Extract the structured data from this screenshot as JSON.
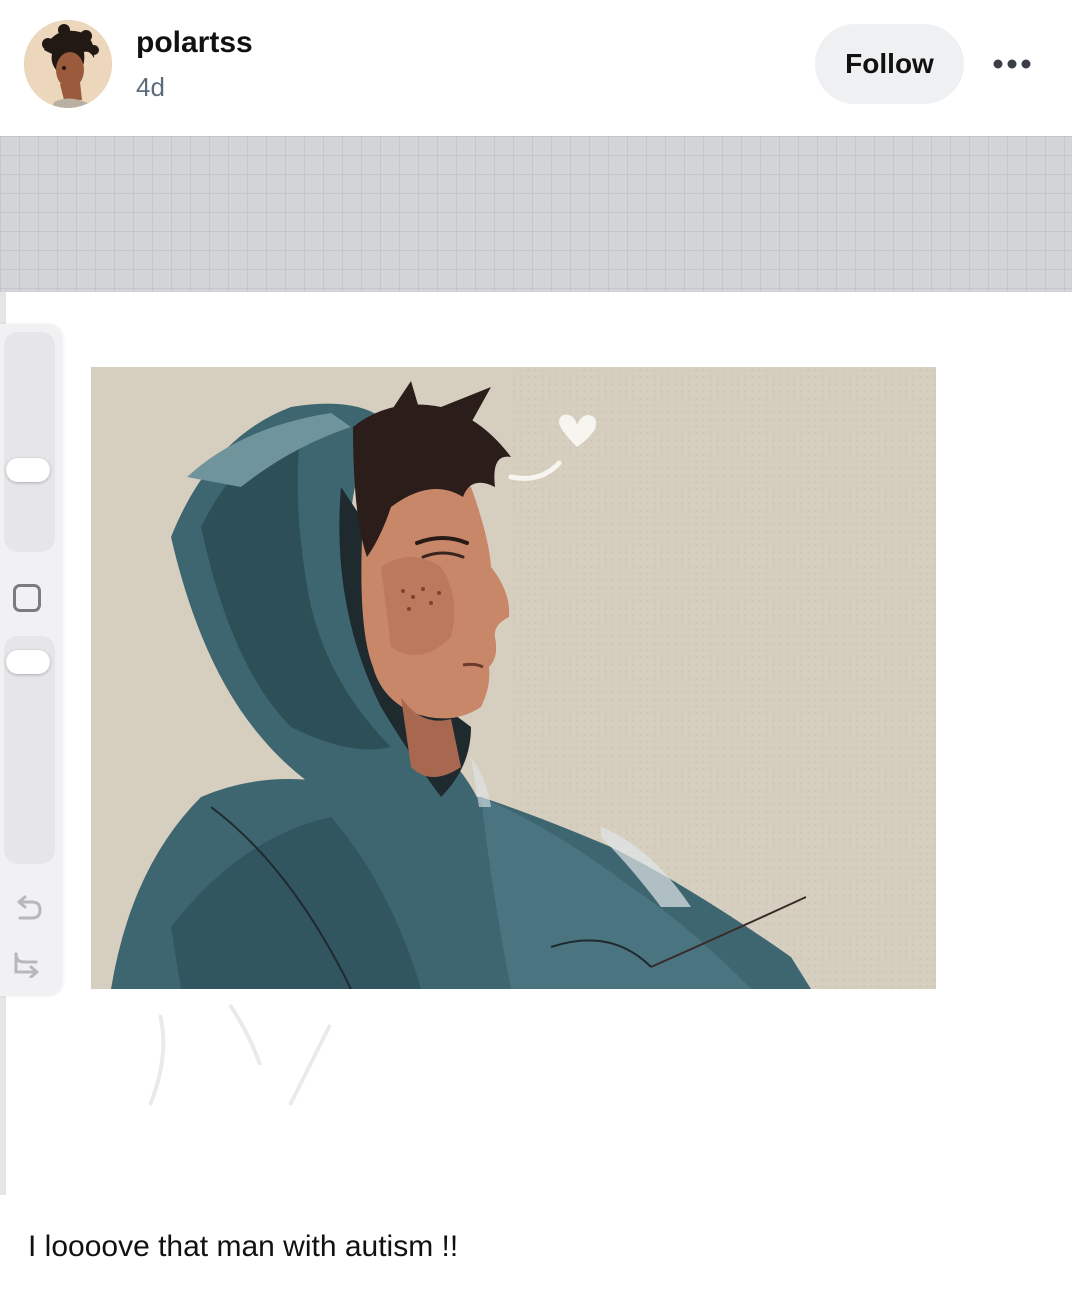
{
  "post": {
    "username": "polartss",
    "timestamp": "4d",
    "follow_label": "Follow",
    "caption": "I loooove that man with autism !!"
  },
  "icons": {
    "avatar": "avatar-illustration",
    "more": "more-options-icon",
    "undo": "undo-icon",
    "redo": "redo-icon",
    "color_square": "square-icon"
  },
  "colors": {
    "follow_bg": "#eef0f2",
    "timestamp": "#5d6b7a",
    "app_bar": "#d2d4d8",
    "hoodie": "#3e6670",
    "art_bg": "#d6cfc0"
  }
}
